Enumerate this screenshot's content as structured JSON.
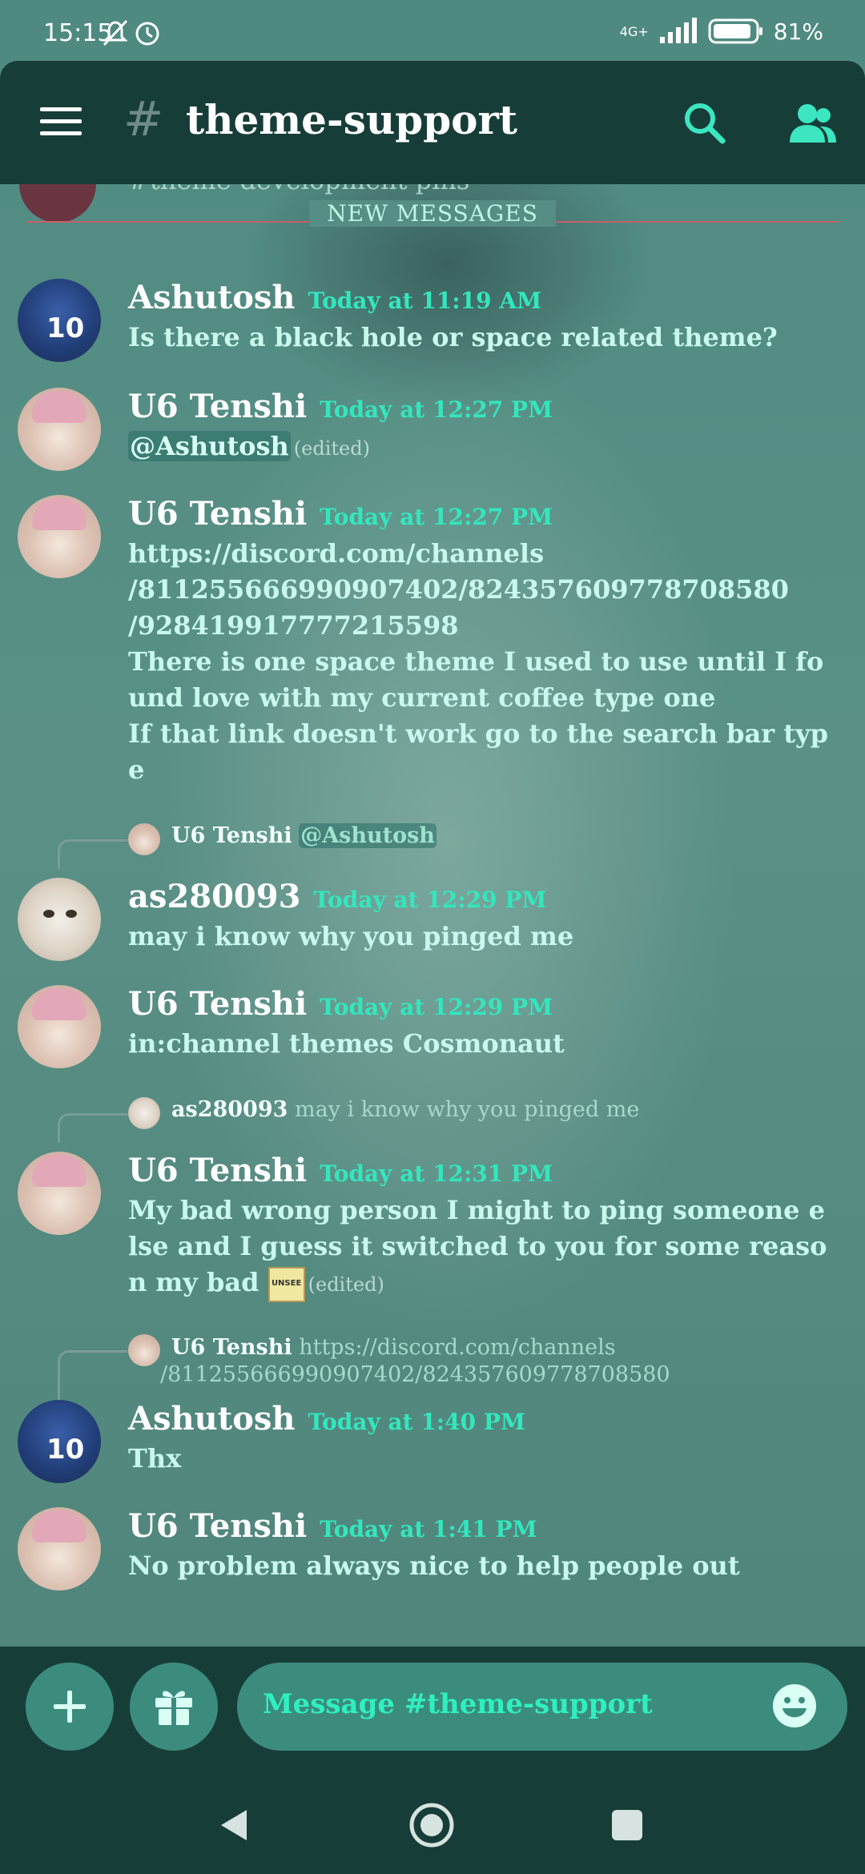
{
  "status_bar": {
    "time": "15:15",
    "network": "4G+",
    "battery": "81%"
  },
  "channel": {
    "hash": "#",
    "name": "theme-support"
  },
  "partial_message_text": "#theme-development pins",
  "divider_label": "NEW MESSAGES",
  "messages": [
    {
      "author": "Ashutosh",
      "timestamp": "Today at 11:19 AM",
      "lines": [
        "Is there a black hole or space related theme?"
      ]
    },
    {
      "author": "U6 Tenshi",
      "timestamp": "Today at 12:27 PM",
      "mention": "@Ashutosh",
      "edited": "(edited)"
    },
    {
      "author": "U6 Tenshi",
      "timestamp": "Today at 12:27 PM",
      "lines": [
        "https://discord.com/channels",
        "/811255666990907402/824357609778708580",
        "/928419917777215598",
        "There is one space theme I used to use until I found love with my current coffee type one",
        "If that link doesn't work go to the search bar type"
      ]
    },
    {
      "reply_to": {
        "author": "U6 Tenshi",
        "content": "@Ashutosh"
      },
      "author": "as280093",
      "timestamp": "Today at 12:29 PM",
      "lines": [
        "may i know why you pinged me"
      ]
    },
    {
      "author": "U6 Tenshi",
      "timestamp": "Today at 12:29 PM",
      "lines": [
        "in:channel themes Cosmonaut"
      ]
    },
    {
      "reply_to": {
        "author": "as280093",
        "content": "may i know why you pinged me"
      },
      "author": "U6 Tenshi",
      "timestamp": "Today at 12:31 PM",
      "lines": [
        "My bad wrong person I might to ping someone else and I guess it switched to you for some reason my bad"
      ],
      "emoji_label": "UNSEE",
      "edited": "(edited)"
    },
    {
      "reply_to": {
        "author": "U6 Tenshi",
        "content": "https://discord.com/channels /811255666990907402/824357609778708580"
      },
      "author": "Ashutosh",
      "timestamp": "Today at 1:40 PM",
      "lines": [
        "Thx"
      ]
    },
    {
      "author": "U6 Tenshi",
      "timestamp": "Today at 1:41 PM",
      "lines": [
        "No problem always nice to help people out"
      ]
    }
  ],
  "composer": {
    "placeholder": "Message #theme-support"
  },
  "colors": {
    "app_bar": "#173d39",
    "timestamp": "#33e7bd",
    "message_text": "#c9f8ee",
    "divider": "#c6606a",
    "button": "#3c8c7e"
  },
  "icons": [
    "menu-icon",
    "search-icon",
    "members-icon",
    "plus-icon",
    "gift-icon",
    "emoji-icon",
    "back-icon",
    "home-icon",
    "recents-icon"
  ]
}
